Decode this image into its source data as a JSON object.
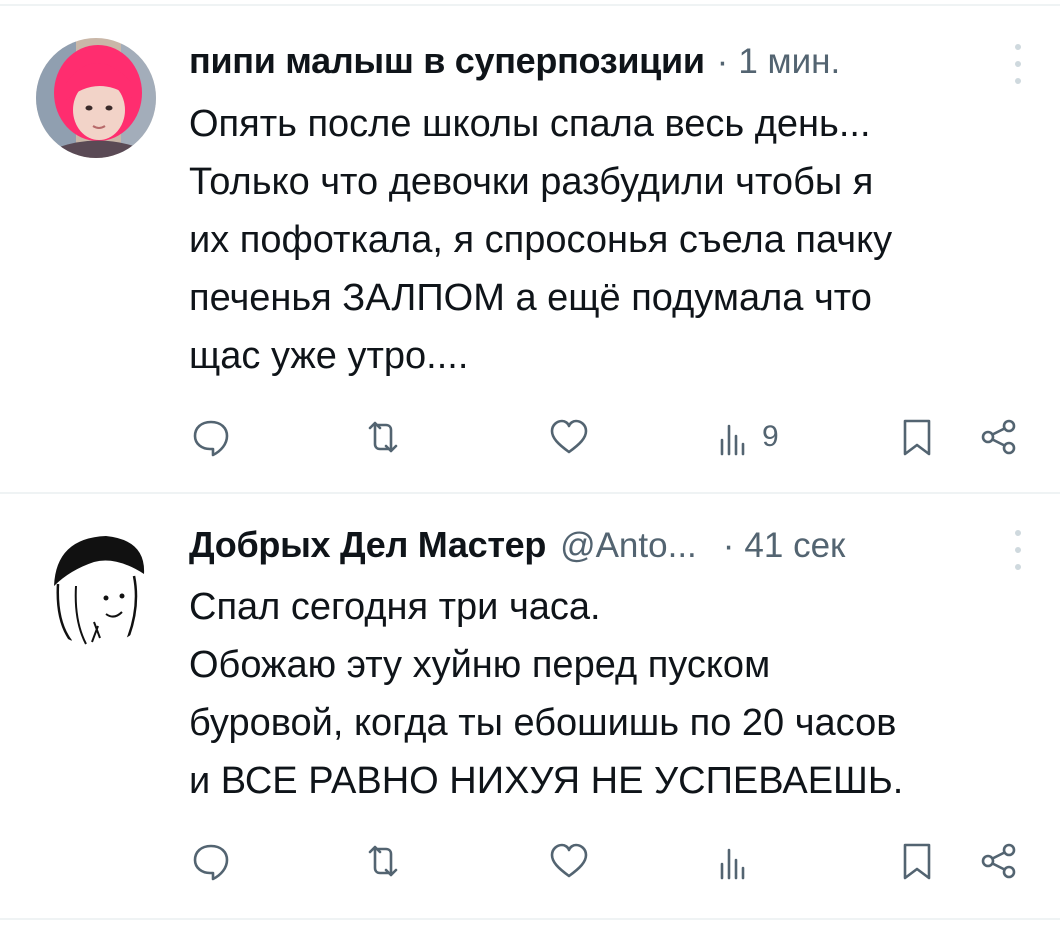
{
  "tweets": [
    {
      "name": "пипи малыш в суперпозиции",
      "handle": "",
      "separator": "·",
      "time": "1 мин.",
      "text": "Опять после школы спала весь день...\nТолько что девочки разбудили чтобы я\nих пофоткала, я спросонья съела пачку\nпеченья ЗАЛПОМ а ещё подумала что\nщас уже утро....",
      "views": "9",
      "avatar_colors": {
        "hair": "#ff2d6f",
        "skin": "#f2d3c8",
        "bg": "#c9b7a8"
      }
    },
    {
      "name": "Добрых Дел Мастер",
      "handle": "@Anto...",
      "separator": "·",
      "time": "41 сек",
      "text": "Спал сегодня три часа.\nОбожаю эту хуйню перед пуском\nбуровой, когда ты ебошишь по 20 часов\nи ВСЕ РАВНО НИХУЯ НЕ УСПЕВАЕШЬ.",
      "views": "",
      "avatar_colors": {
        "hair": "#111111",
        "bg": "#ffffff"
      }
    }
  ],
  "icons": {
    "reply": "speech-bubble-icon",
    "retweet": "retweet-arrows-icon",
    "like": "heart-icon",
    "views": "bar-chart-icon",
    "bookmark": "bookmark-icon",
    "share": "share-nodes-icon",
    "more": "vertical-dots-icon"
  },
  "colors": {
    "text": "#0f1419",
    "secondary": "#536471",
    "divider": "#eff3f4"
  }
}
